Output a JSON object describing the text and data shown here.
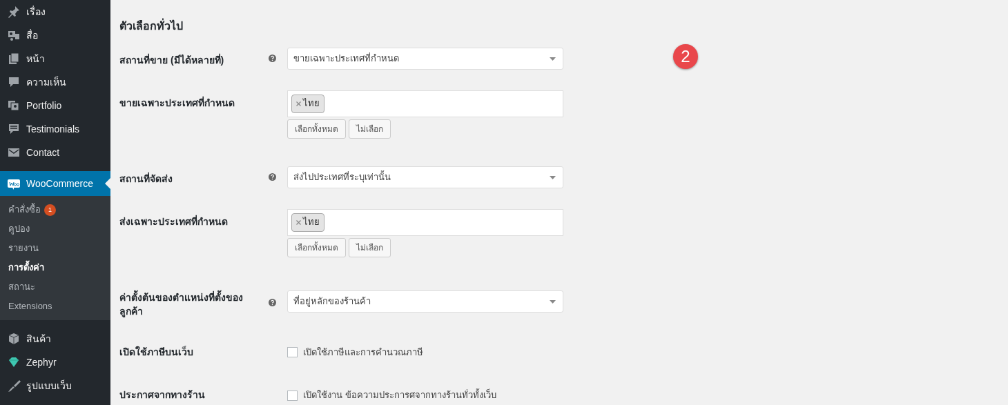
{
  "sidebar": {
    "items": [
      {
        "label": "เรื่อง",
        "selected": false
      },
      {
        "label": "สื่อ",
        "selected": false
      },
      {
        "label": "หน้า",
        "selected": false
      },
      {
        "label": "ความเห็น",
        "selected": false
      },
      {
        "label": "Portfolio",
        "selected": false
      },
      {
        "label": "Testimonials",
        "selected": false
      },
      {
        "label": "Contact",
        "selected": false
      },
      {
        "label": "WooCommerce",
        "selected": true,
        "children": [
          {
            "label": "คำสั่งซื้อ",
            "badge": "1",
            "selected": false
          },
          {
            "label": "คูปอง",
            "selected": false
          },
          {
            "label": "รายงาน",
            "selected": false
          },
          {
            "label": "การตั้งค่า",
            "selected": true
          },
          {
            "label": "สถานะ",
            "selected": false
          },
          {
            "label": "Extensions",
            "selected": false
          }
        ]
      },
      {
        "label": "สินค้า",
        "selected": false
      },
      {
        "label": "Zephyr",
        "selected": false
      },
      {
        "label": "รูปแบบเว็บ",
        "selected": false
      }
    ]
  },
  "section_title": "ตัวเลือกทั่วไป",
  "step_marker": "2",
  "settings": [
    {
      "kind": "select",
      "label": "สถานที่ขาย (มีได้หลายที่)",
      "help": true,
      "value": "ขายเฉพาะประเทศที่กำหนด"
    },
    {
      "kind": "multiselect",
      "label": "ขายเฉพาะประเทศที่กำหนด",
      "help": false,
      "tags": [
        "ไทย"
      ],
      "buttons": [
        "เลือกทั้งหมด",
        "ไม่เลือก"
      ]
    },
    {
      "kind": "select",
      "label": "สถานที่จัดส่ง",
      "help": true,
      "value": "ส่งไปประเทศที่ระบุเท่านั้น"
    },
    {
      "kind": "multiselect",
      "label": "ส่งเฉพาะประเทศที่กำหนด",
      "help": false,
      "tags": [
        "ไทย"
      ],
      "buttons": [
        "เลือกทั้งหมด",
        "ไม่เลือก"
      ]
    },
    {
      "kind": "select",
      "label": "ค่าตั้งต้นของตำแหน่งที่ตั้งของลูกค้า",
      "help": true,
      "value": "ที่อยู่หลักของร้านค้า"
    },
    {
      "kind": "checkbox",
      "label": "เปิดใช้ภาษีบนเว็บ",
      "help": false,
      "text": "เปิดใช้ภาษีและการคำนวณภาษี",
      "checked": false
    },
    {
      "kind": "checkbox",
      "label": "ประกาศจากทางร้าน",
      "help": false,
      "text": "เปิดใช้งาน ข้อความประการศจากทางร้านทั่วทั้งเว็บ",
      "checked": false
    }
  ]
}
